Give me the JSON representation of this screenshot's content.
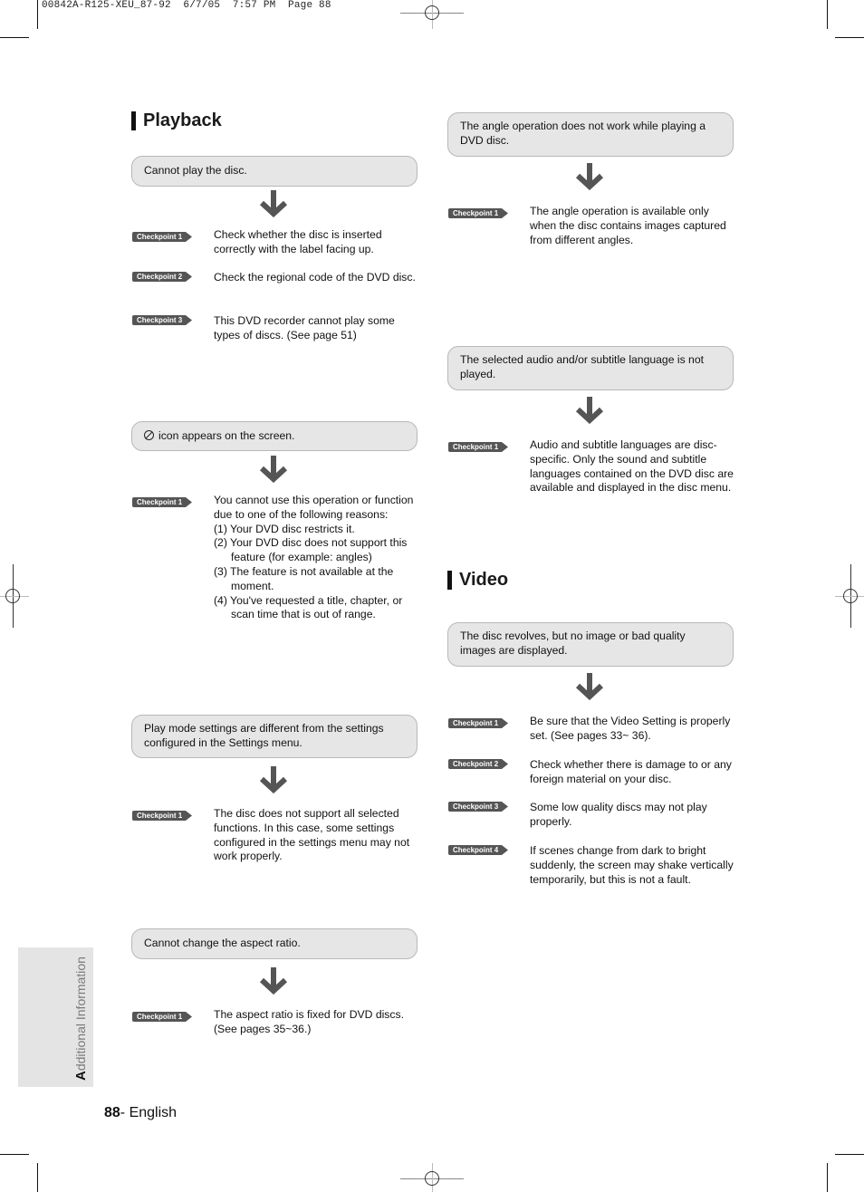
{
  "slug": "00842A-R125-XEU_87-92  6/7/05  7:57 PM  Page 88",
  "colors": {
    "problem_bg": "#e6e6e6",
    "problem_border": "#b8b8b8",
    "checkpoint_bg": "#555555",
    "arrow": "#555555",
    "side_tab_bg": "#e4e4e4"
  },
  "sections": {
    "playback": {
      "title": "Playback",
      "issues": [
        {
          "problem": "Cannot play the disc.",
          "checkpoints": [
            {
              "label": "Checkpoint 1",
              "text": "Check whether the disc is inserted correctly with the label facing up."
            },
            {
              "label": "Checkpoint 2",
              "text": "Check the regional code of the DVD disc."
            },
            {
              "label": "Checkpoint 3",
              "text": "This DVD recorder cannot play some types of discs. (See page 51)"
            }
          ]
        },
        {
          "problem_icon": "no-entry-icon",
          "problem": "icon appears on the screen.",
          "checkpoints": [
            {
              "label": "Checkpoint 1",
              "text": "You cannot use this operation or function due to one of the following reasons:",
              "list": [
                "(1) Your DVD disc restricts it.",
                "(2) Your DVD disc does not support this feature (for example: angles)",
                "(3) The feature is not available at the moment.",
                "(4) You've requested a title, chapter, or scan time that is out of range."
              ]
            }
          ]
        },
        {
          "problem": "Play mode settings are different from the settings configured in the Settings menu.",
          "checkpoints": [
            {
              "label": "Checkpoint 1",
              "text": "The disc does not support all selected functions. In this case, some settings configured in the settings menu may not work properly."
            }
          ]
        },
        {
          "problem": "Cannot change the aspect ratio.",
          "checkpoints": [
            {
              "label": "Checkpoint 1",
              "text": "The aspect ratio is fixed for DVD discs. (See pages 35~36.)"
            }
          ]
        },
        {
          "problem": "The angle operation does not work while playing a DVD disc.",
          "checkpoints": [
            {
              "label": "Checkpoint 1",
              "text": "The angle operation is available only when the disc contains images captured from different angles."
            }
          ]
        },
        {
          "problem": "The selected audio and/or subtitle language is not played.",
          "checkpoints": [
            {
              "label": "Checkpoint 1",
              "text": "Audio and subtitle languages are disc-specific. Only the sound and subtitle languages contained on the DVD disc are available and displayed in the disc menu."
            }
          ]
        }
      ]
    },
    "video": {
      "title": "Video",
      "issues": [
        {
          "problem": "The disc revolves, but no image or bad quality images are displayed.",
          "checkpoints": [
            {
              "label": "Checkpoint 1",
              "text": "Be sure that the Video Setting is properly set. (See pages 33~ 36)."
            },
            {
              "label": "Checkpoint 2",
              "text": "Check whether there is damage to or any foreign material on your disc."
            },
            {
              "label": "Checkpoint 3",
              "text": "Some low quality discs may not play properly."
            },
            {
              "label": "Checkpoint 4",
              "text": "If scenes change from dark to bright suddenly, the screen may shake vertically temporarily, but this is not a fault."
            }
          ]
        }
      ]
    }
  },
  "side_tab": {
    "initial": "A",
    "rest": "dditional Information"
  },
  "footer": {
    "page_number": "88",
    "language": "- English"
  }
}
